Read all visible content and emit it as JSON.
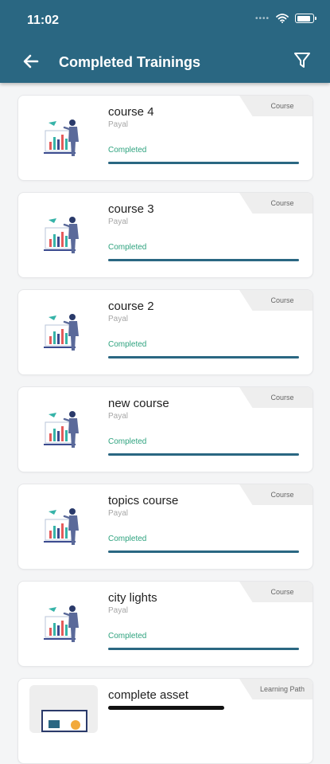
{
  "status_bar": {
    "time": "11:02"
  },
  "header": {
    "title": "Completed Trainings"
  },
  "trainings": [
    {
      "title": "course 4",
      "author": "Payal",
      "status": "Completed",
      "type": "Course",
      "progress": 1.0
    },
    {
      "title": "course 3",
      "author": "Payal",
      "status": "Completed",
      "type": "Course",
      "progress": 1.0
    },
    {
      "title": "course 2",
      "author": "Payal",
      "status": "Completed",
      "type": "Course",
      "progress": 1.0
    },
    {
      "title": "new course",
      "author": "Payal",
      "status": "Completed",
      "type": "Course",
      "progress": 1.0
    },
    {
      "title": "topics course",
      "author": "Payal",
      "status": "Completed",
      "type": "Course",
      "progress": 1.0
    },
    {
      "title": "city lights",
      "author": "Payal",
      "status": "Completed",
      "type": "Course",
      "progress": 1.0
    },
    {
      "title": "complete asset",
      "type": "Learning Path"
    }
  ],
  "colors": {
    "header_bg": "#2a6782",
    "progress": "#2a6782",
    "status_completed": "#2fa37f"
  },
  "icons": {
    "back": "arrow-left-icon",
    "filter": "filter-funnel-icon",
    "wifi": "wifi-icon",
    "battery": "battery-icon",
    "course_thumb": "presentation-chart-illustration"
  }
}
